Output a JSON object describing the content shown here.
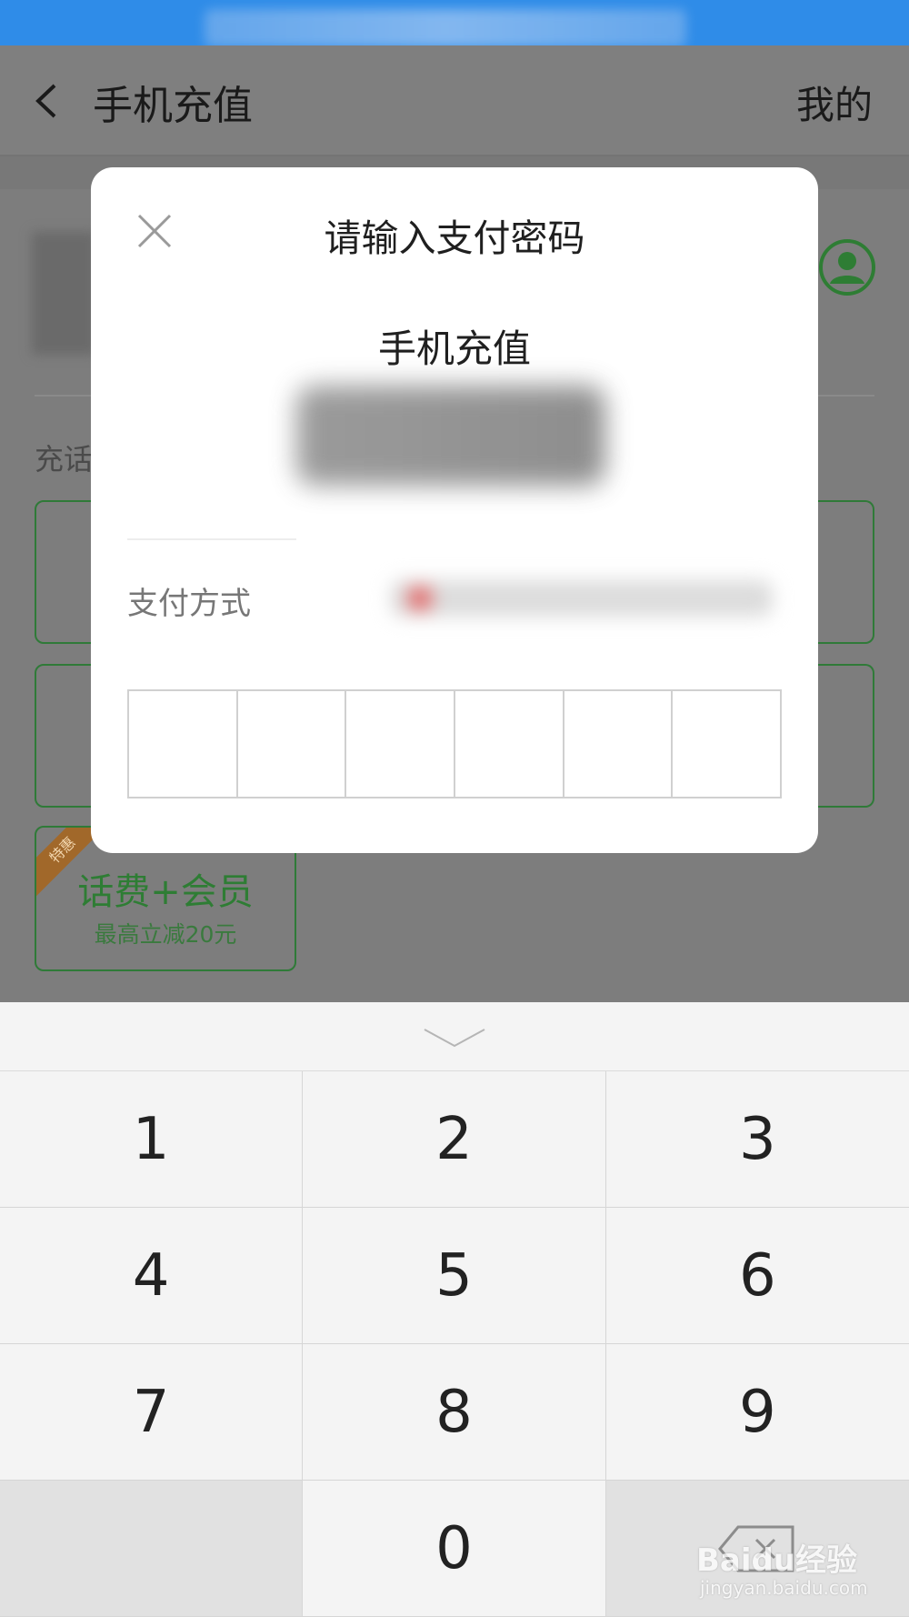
{
  "header": {
    "title": "手机充值",
    "mine_label": "我的"
  },
  "background": {
    "charge_label": "充话",
    "promo": {
      "ribbon": "特惠",
      "title": "话费+会员",
      "subtitle": "最高立减20元"
    }
  },
  "modal": {
    "title": "请输入支付密码",
    "subtitle": "手机充值",
    "pay_method_label": "支付方式",
    "password_length": 6
  },
  "keypad": {
    "keys": [
      "1",
      "2",
      "3",
      "4",
      "5",
      "6",
      "7",
      "8",
      "9",
      "",
      "0",
      ""
    ]
  },
  "watermark": {
    "text": "Baidu经验",
    "sub": "jingyan.baidu.com"
  },
  "colors": {
    "status_bar": "#2f8ce8",
    "accent_green": "#2e7d34",
    "overlay": "#7d7d7d"
  }
}
